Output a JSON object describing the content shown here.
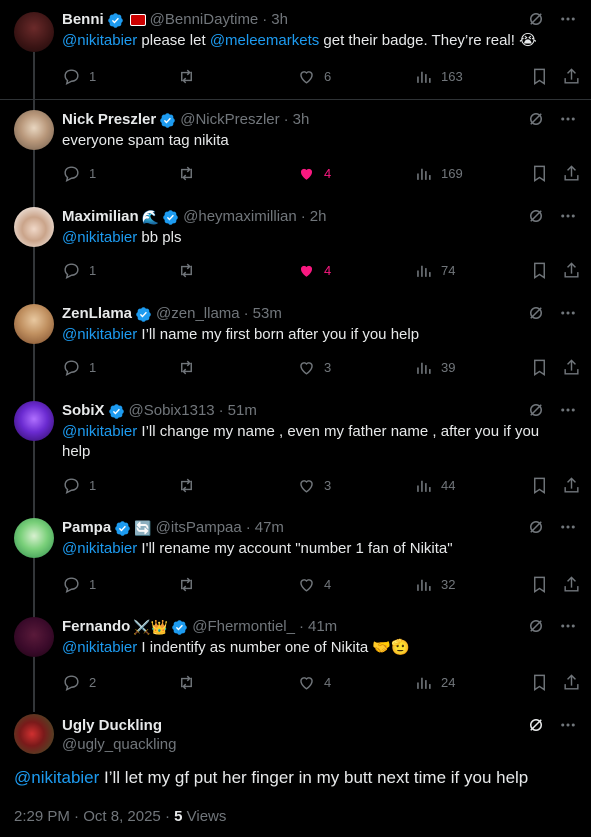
{
  "replies": [
    {
      "name": "Benni",
      "emoji": "▬",
      "handle": "@BenniDaytime",
      "time": "3h",
      "mention": "@nikitabier",
      "text_mid": " please let ",
      "mention2": "@meleemarkets",
      "text_end": " get their badge. They’re real! 😭",
      "replies": "1",
      "retweets": "",
      "likes": "6",
      "views": "163",
      "liked": false
    },
    {
      "name": "Nick Preszler",
      "emoji": "",
      "handle": "@NickPreszler",
      "time": "3h",
      "mention": "",
      "text": "everyone spam tag nikita",
      "replies": "1",
      "retweets": "",
      "likes": "4",
      "views": "169",
      "liked": true
    },
    {
      "name": "Maximilian",
      "emoji": "🌊",
      "handle": "@heymaximillian",
      "time": "2h",
      "mention": "@nikitabier",
      "text": " bb pls",
      "replies": "1",
      "retweets": "",
      "likes": "4",
      "views": "74",
      "liked": true
    },
    {
      "name": "ZenLlama",
      "emoji": "",
      "handle": "@zen_llama",
      "time": "53m",
      "mention": "@nikitabier",
      "text": " I’ll name my first born after you if you help",
      "replies": "1",
      "retweets": "",
      "likes": "3",
      "views": "39",
      "liked": false
    },
    {
      "name": "SobiX",
      "emoji": "",
      "handle": "@Sobix1313",
      "time": "51m",
      "mention": "@nikitabier",
      "text": " I’ll change my name , even my father name , after you if you help",
      "replies": "1",
      "retweets": "",
      "likes": "3",
      "views": "44",
      "liked": false
    },
    {
      "name": "Pampa",
      "emoji": "🔄",
      "handle": "@itsPampaa",
      "time": "47m",
      "mention": "@nikitabier",
      "text": " I'll rename my account \"number 1 fan of Nikita\"",
      "replies": "1",
      "retweets": "",
      "likes": "4",
      "views": "32",
      "liked": false
    },
    {
      "name": "Fernando",
      "emoji": "⚔️👑",
      "handle": "@Fhermontiel_",
      "time": "41m",
      "mention": "@nikitabier",
      "text": " I indentify as number one of Nikita 🤝🫡",
      "replies": "2",
      "retweets": "",
      "likes": "4",
      "views": "24",
      "liked": false
    }
  ],
  "main": {
    "name": "Ugly Duckling",
    "handle": "@ugly_quackling",
    "mention": "@nikitabier",
    "text": " I’ll let my gf put her finger in my butt next time if you help",
    "time": "2:29 PM",
    "date": "Oct 8, 2025",
    "views_count": "5",
    "views_label": "Views"
  },
  "colors": {
    "accent": "#1d9bf0",
    "like": "#f91880",
    "muted": "#71767b",
    "text": "#e7e9ea"
  }
}
